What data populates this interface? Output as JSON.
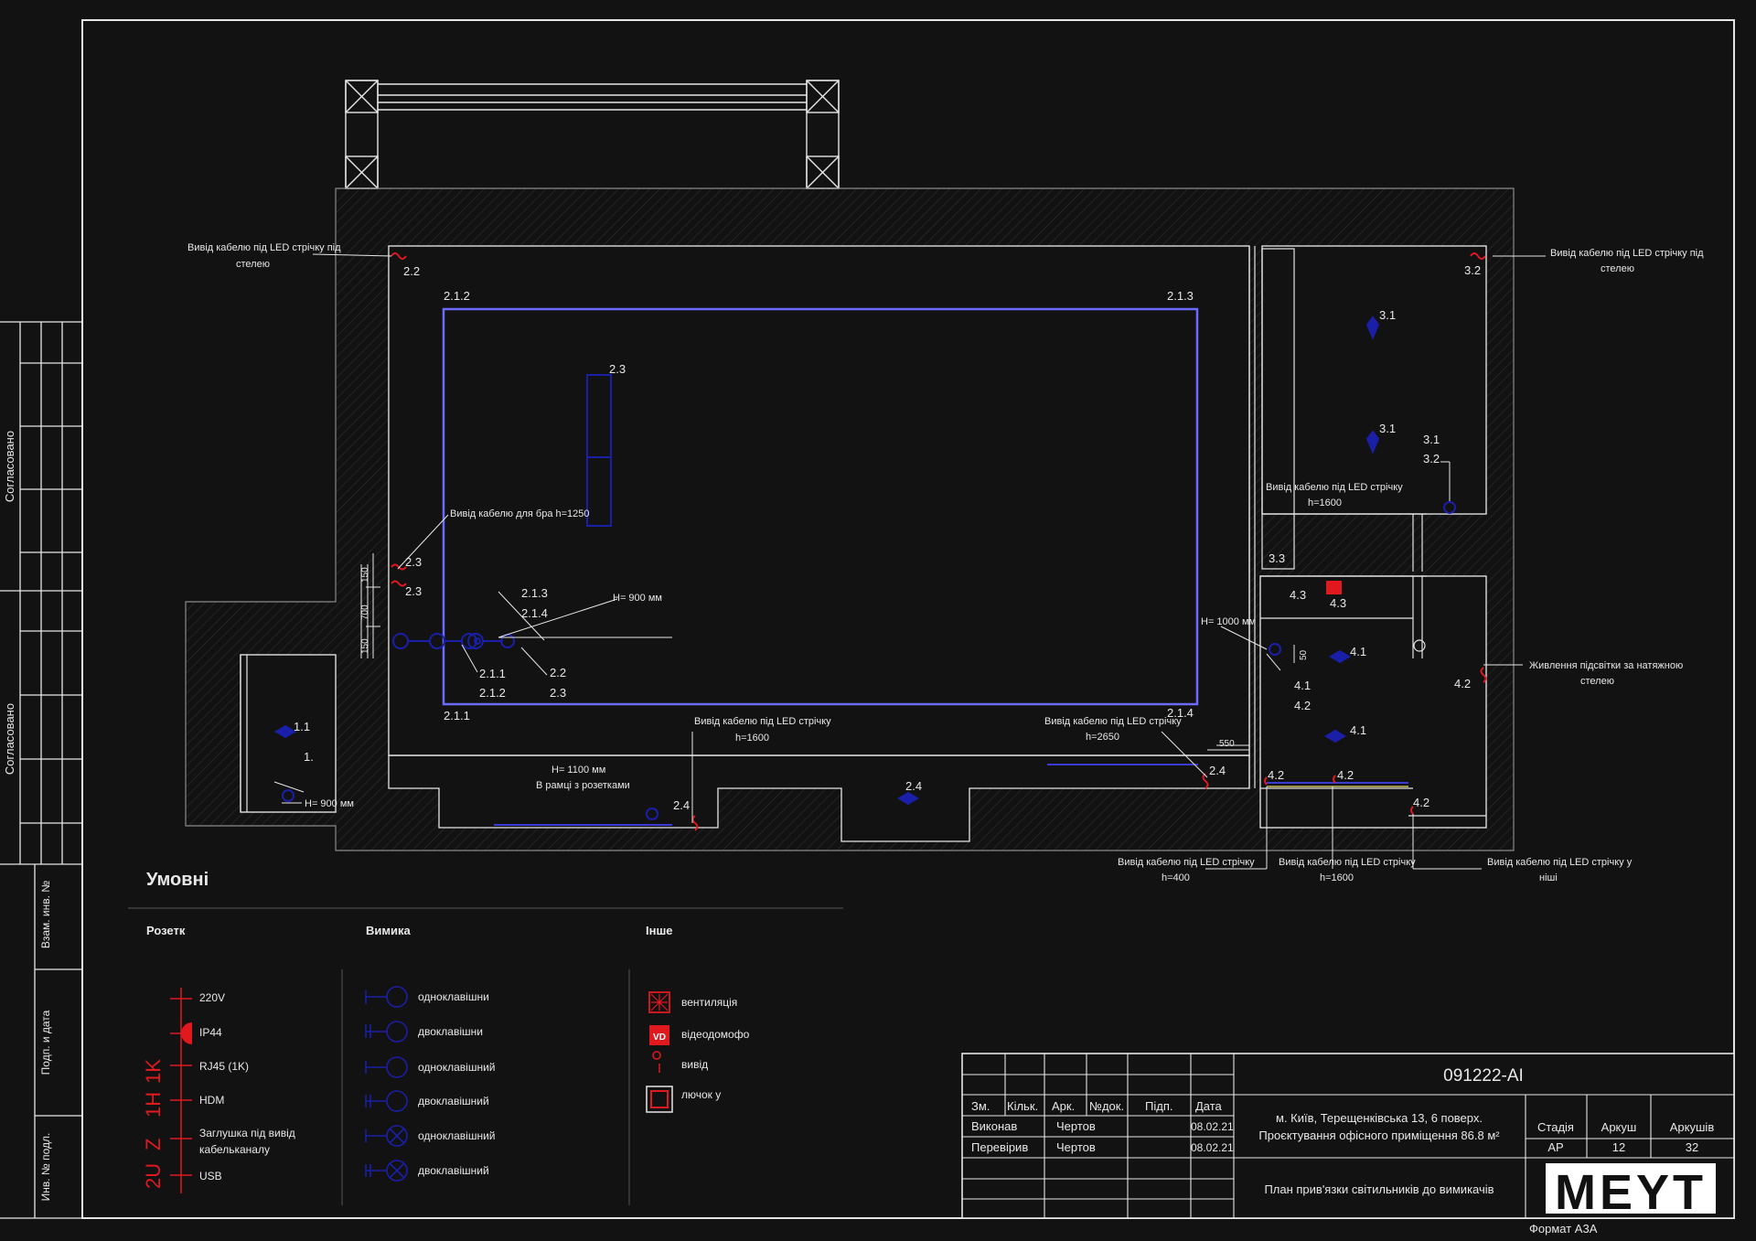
{
  "sheet": {
    "code": "091222-AI",
    "address_line1": "м. Київ, Терещенківська 13, 6 поверх.",
    "address_line2": "Проєктування офісного приміщення 86.8 м²",
    "drawing_title": "План прив'язки світильників до вимикачів",
    "format": "Формат A3A",
    "logo": "MEYT",
    "headers": {
      "zm": "Зм.",
      "kilk": "Кільк.",
      "ark": "Арк.",
      "ndok": "№док.",
      "pidp": "Підп.",
      "data": "Дата"
    },
    "rows": [
      {
        "role": "Виконав",
        "name": "Чертов",
        "date": "08.02.21"
      },
      {
        "role": "Перевірив",
        "name": "Чертов",
        "date": "08.02.21"
      }
    ],
    "stage_header": "Стадія",
    "sheet_header": "Аркуш",
    "sheets_header": "Аркушів",
    "stage": "AP",
    "sheet_no": "12",
    "sheets_total": "32"
  },
  "side_strip": {
    "approved_1": "Согласовано",
    "approved_2": "Согласовано",
    "inv_swap": "Взам. инв. №",
    "sign_date": "Подп. и дата",
    "inv_orig": "Инв. № подл."
  },
  "legend": {
    "title": "Умовні",
    "col_sockets": "Розетк",
    "col_switches": "Вимика",
    "col_other": "Інше",
    "sockets": [
      "220V",
      "IP44",
      "RJ45 (1K)",
      "HDM",
      "Заглушка під  вивід",
      "кабельканалу",
      "USB"
    ],
    "socket_codes": [
      "1K",
      "1H",
      "Z",
      "2U"
    ],
    "switches": [
      "одноклавішни",
      "двоклавішни",
      "одноклавішний",
      "двоклавішний",
      "одноклавішний",
      "двоклавішний"
    ],
    "other": [
      "вентиляція",
      "відеодомофо",
      "вивід",
      "лючок у"
    ],
    "vd": "VD"
  },
  "labels": {
    "led_ceiling_left_1": "Вивід кабелю під LED стрічку під",
    "led_ceiling_left_2": "стелею",
    "led_ceiling_right_1": "Вивід кабелю під LED стрічку під",
    "led_ceiling_right_2": "стелею",
    "bra": "Вивід кабелю для бра h=1250",
    "h900_a": "H= 900 мм",
    "h900_b": "H= 900 мм",
    "h1100_1": "H= 1100 мм",
    "h1100_2": "В рамці з розетками",
    "led_1600_a_1": "Вивід кабелю під LED стрічку",
    "led_1600_a_2": "h=1600",
    "led_2650_1": "Вивід кабелю під LED стрічку",
    "led_2650_2": "h=2650",
    "led_1600_b_1": "Вивід кабелю під LED стрічку",
    "led_1600_b_2": "h=1600",
    "h1000": "H= 1000 мм",
    "stretch_1": "Живлення підсвітки за натяжною",
    "stretch_2": "стелею",
    "led_400_1": "Вивід кабелю під LED стрічку",
    "led_400_2": "h=400",
    "led_1600_c_1": "Вивід кабелю під LED стрічку",
    "led_1600_c_2": "h=1600",
    "led_niche_1": "Вивід кабелю під LED стрічку у",
    "led_niche_2": "ніші",
    "d150a": "150",
    "d700": "700",
    "d150b": "150",
    "d550": "550",
    "d50": "50",
    "n22": "2.2",
    "n212": "2.1.2",
    "n213": "2.1.3",
    "n23a": "2.3",
    "n23b": "2.3",
    "n23c": "2.3",
    "n213b": "2.1.3",
    "n214": "2.1.4",
    "n211a": "2.1.1",
    "n212b": "2.1.2",
    "n22b": "2.2",
    "n23d": "2.3",
    "n211b": "2.1.1",
    "n214b": "2.1.4",
    "n24a": "2.4",
    "n24b": "2.4",
    "n24c": "2.4",
    "n11": "1.1",
    "n1": "1.",
    "n32a": "3.2",
    "n31a": "3.1",
    "n31b": "3.1",
    "n31c": "3.1",
    "n32b": "3.2",
    "n33": "3.3",
    "n43a": "4.3",
    "n43b": "4.3",
    "n41a": "4.1",
    "n41b": "4.1",
    "n42a": "4.2",
    "n41c": "4.1",
    "n42b": "4.2",
    "n42c": "4.2",
    "n42d": "4.2",
    "n42e": "4.2"
  },
  "colors": {
    "background": "#121212",
    "lines": "#e6e6e6",
    "fixtures": "#1a1fa8",
    "ceiling_outline": "#6b6bff",
    "accent_red": "#e0191f"
  }
}
